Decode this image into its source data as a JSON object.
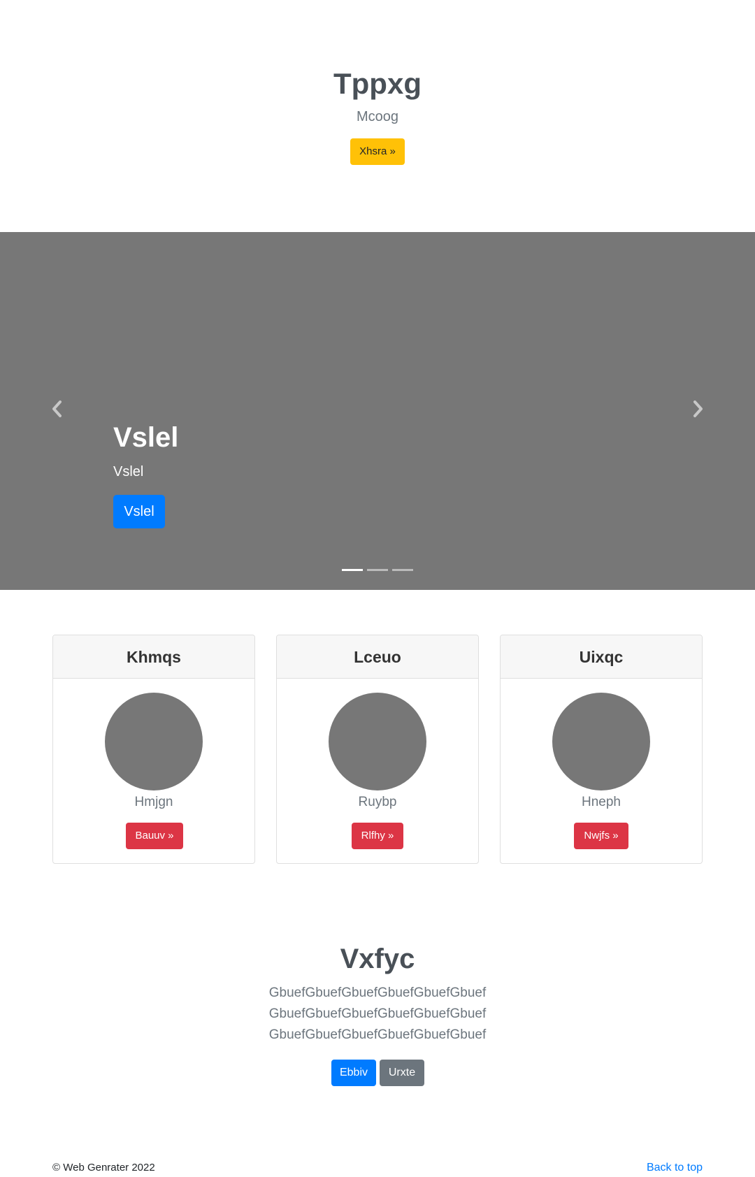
{
  "hero": {
    "title": "Tppxg",
    "subtitle": "Mcoog",
    "button_label": "Xhsra »"
  },
  "carousel": {
    "slide": {
      "title": "Vslel",
      "text": "Vslel",
      "button_label": "Vslel"
    },
    "indicator_count": 3,
    "active_index": 0,
    "icons": {
      "prev": "chevron-left-icon",
      "next": "chevron-right-icon"
    }
  },
  "cards": [
    {
      "header": "Khmqs",
      "name": "Hmjgn",
      "button_label": "Bauuv »"
    },
    {
      "header": "Lceuo",
      "name": "Ruybp",
      "button_label": "Rlfhy »"
    },
    {
      "header": "Uixqc",
      "name": "Hneph",
      "button_label": "Nwjfs »"
    }
  ],
  "section": {
    "title": "Vxfyc",
    "lines": [
      "GbuefGbuefGbuefGbuefGbuefGbuef",
      "GbuefGbuefGbuefGbuefGbuefGbuef",
      "GbuefGbuefGbuefGbuefGbuefGbuef"
    ],
    "primary_label": "Ebbiv",
    "secondary_label": "Urxte"
  },
  "footer": {
    "copyright": "© Web Genrater 2022",
    "back_to_top": "Back to top"
  },
  "colors": {
    "primary": "#007bff",
    "warning": "#ffc107",
    "danger": "#dc3545",
    "secondary": "#6c757d",
    "placeholder_gray": "#777777"
  }
}
